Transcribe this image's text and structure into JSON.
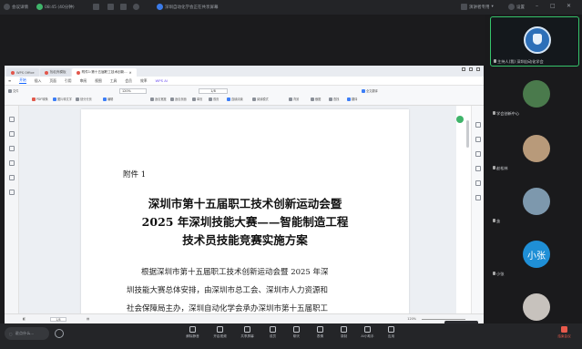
{
  "topbar": {
    "meeting_name": "会议详情",
    "time": "08:45 (40分钟)",
    "share_label": "深圳自动化学会正在共享屏幕",
    "speaker_label": "演讲者专用",
    "settings_label": "设置"
  },
  "wps": {
    "tabs": [
      {
        "label": "WPS Office"
      },
      {
        "label": "找稻壳模板"
      },
      {
        "label": "附件1:第十五届职工技术创新..."
      }
    ],
    "menu": [
      "开始",
      "插入",
      "页面",
      "引用",
      "审阅",
      "视图",
      "工具",
      "会员",
      "效率",
      "WPS AI"
    ],
    "active_menu": "开始",
    "ribbon": {
      "items": [
        "文件",
        "PDF转换",
        "图片转文字",
        "划分分页",
        "编辑",
        "注释",
        "开始编辑",
        "目录",
        "页面",
        "适合宽度",
        "适合页面",
        "单页",
        "双页",
        "连续阅读",
        "背景",
        "截图",
        "查找",
        "翻译",
        "阅读模式",
        "全文翻译"
      ],
      "zoom": "120%",
      "page": "1/8"
    },
    "document": {
      "attachment": "附件 1",
      "title_lines": [
        "深圳市第十五届职工技术创新运动会暨",
        "2025 年深圳技能大赛——智能制造工程",
        "技术员技能竞赛实施方案"
      ],
      "body_lines": [
        "根据深圳市第十五届职工技术创新运动会暨 2025 年深",
        "圳技能大赛总体安排，由深圳市总工会、深圳市人力资源和",
        "社会保障局主办，深圳自动化学会承办深圳市第十五届职工"
      ]
    },
    "status": {
      "page": "1/8",
      "zoom": "120%"
    }
  },
  "annotation_button": "批注",
  "participants": [
    {
      "name": "主持人(我)  深圳自动化学会",
      "avatar_color": "#2d6fb8"
    },
    {
      "name": "学会创新中心",
      "avatar_color": "#4a7a4c"
    },
    {
      "name": "赵松林",
      "avatar_color": "#b89a7a"
    },
    {
      "name": "茧",
      "avatar_color": "#7d98ad"
    },
    {
      "name": "小张",
      "avatar_color": "#1f8fd6",
      "avatar_text": "小张"
    },
    {
      "name": "",
      "avatar_color": "#c7c2bd"
    }
  ],
  "bottombar": {
    "chat_placeholder": "说点什么...",
    "buttons": [
      "解除静音",
      "开启视频",
      "共享屏幕",
      "成员",
      "聊天",
      "表情",
      "录制",
      "AI小助手",
      "应用",
      "结束会议"
    ]
  },
  "colors": {
    "accent": "#1463ff",
    "active_speaker": "#36c46b",
    "end_button": "#e85a4c"
  }
}
